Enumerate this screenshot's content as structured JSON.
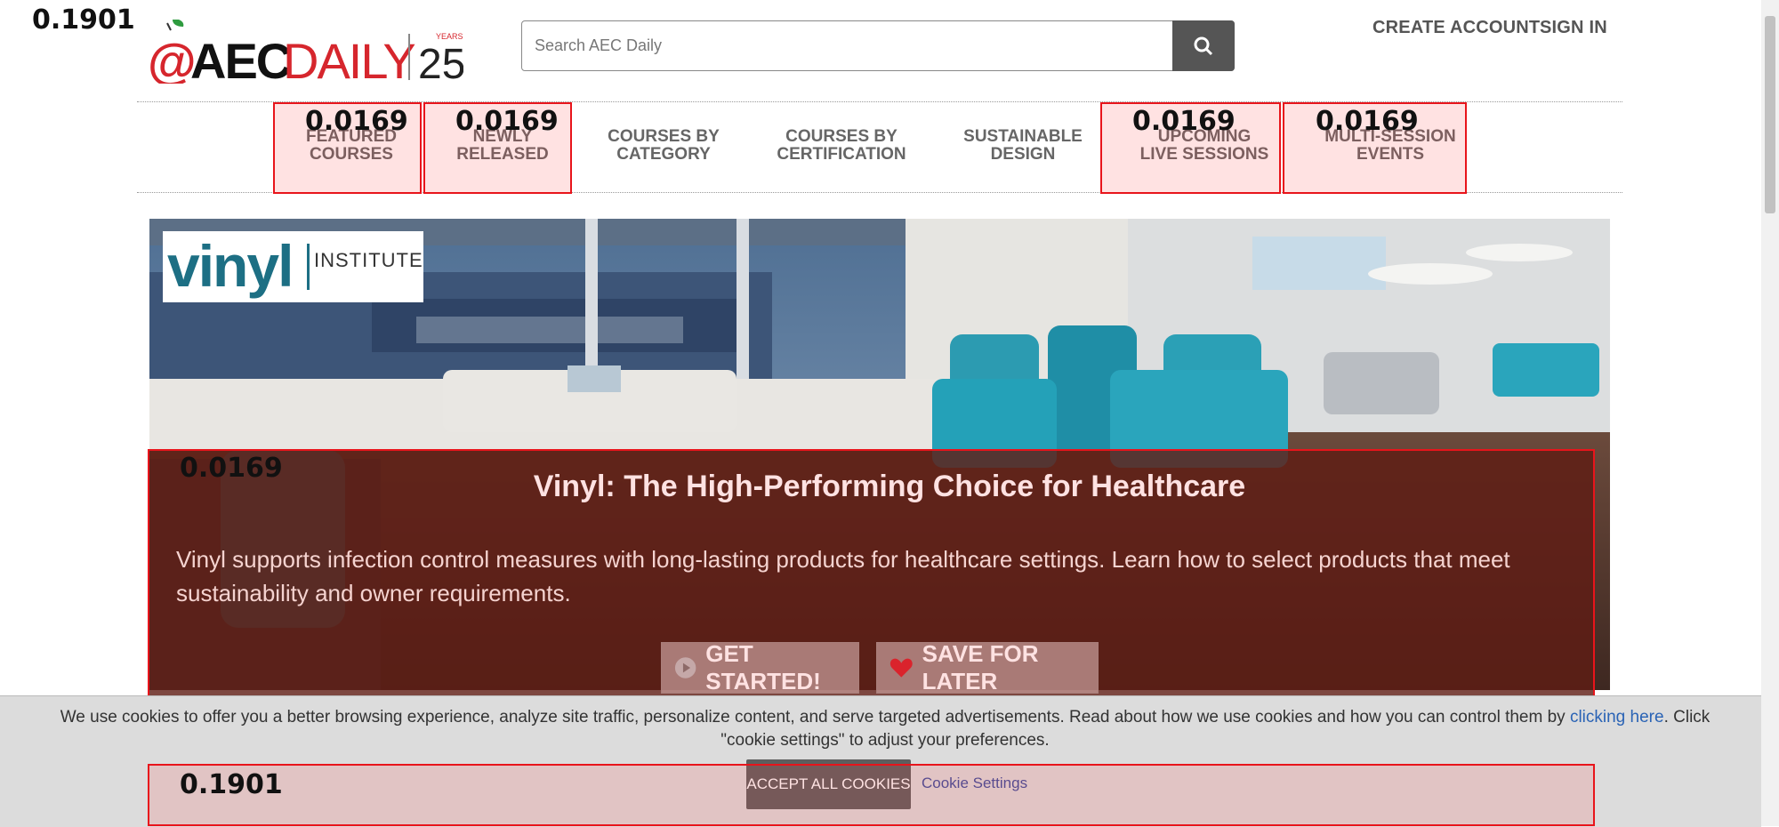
{
  "scores": {
    "top_left": "0.1901",
    "nav_featured": "0.0169",
    "nav_newly": "0.0169",
    "nav_upcoming": "0.0169",
    "nav_multi": "0.0169",
    "hero": "0.0169",
    "cookie": "0.1901"
  },
  "header": {
    "logo_text_at": "@",
    "logo_text_aec": "AEC",
    "logo_text_daily": "DAILY",
    "logo_years_num": "25",
    "logo_years_label": "YEARS",
    "search_placeholder": "Search AEC Daily",
    "create_account": "CREATE ACCOUNT",
    "sign_in": "SIGN IN"
  },
  "nav": {
    "featured": [
      "FEATURED",
      "COURSES"
    ],
    "newly": [
      "NEWLY",
      "RELEASED"
    ],
    "category": [
      "COURSES BY",
      "CATEGORY"
    ],
    "certification": [
      "COURSES BY",
      "CERTIFICATION"
    ],
    "sustainable": [
      "SUSTAINABLE",
      "DESIGN"
    ],
    "upcoming": [
      "UPCOMING",
      "LIVE SESSIONS"
    ],
    "multi": [
      "MULTI-SESSION",
      "EVENTS"
    ]
  },
  "hero": {
    "sponsor_word": "vinyl",
    "sponsor_sub": "INSTITUTE",
    "title": "Vinyl: The High-Performing Choice for Healthcare",
    "description": "Vinyl supports infection control measures with long-lasting products for healthcare settings. Learn how to select products that meet sustainability and owner requirements.",
    "get_started": "GET STARTED!",
    "save_later": "SAVE FOR LATER"
  },
  "cookie": {
    "text_before": "We use cookies to offer you a better browsing experience, analyze site traffic, personalize content, and serve targeted advertisements. Read about how we use cookies and how you can control them by ",
    "link": "clicking here",
    "text_after": ". Click \"cookie settings\" to adjust your preferences.",
    "accept": "ACCEPT ALL COOKIES",
    "settings": "Cookie Settings"
  },
  "colors": {
    "brand_red": "#d6262d",
    "overlay": "#3c160c",
    "highlight": "#e8141b",
    "vinyl_teal": "#1d6f84"
  }
}
